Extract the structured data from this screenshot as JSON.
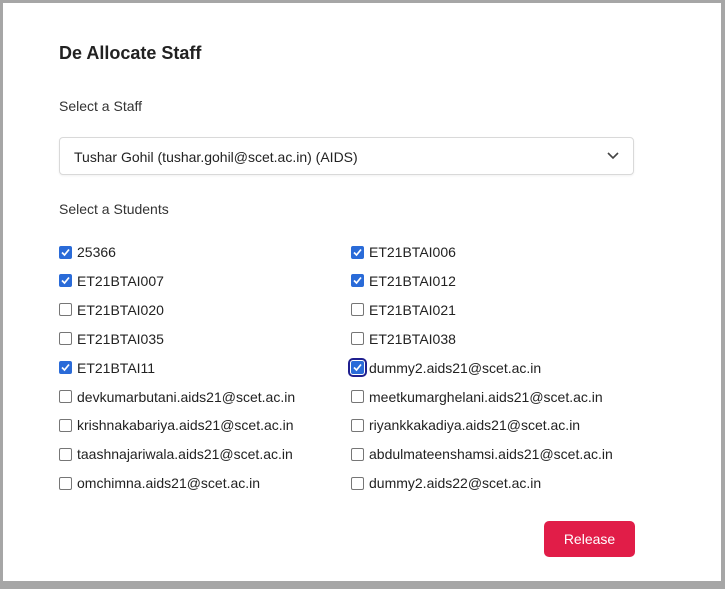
{
  "modal": {
    "title": "De Allocate Staff",
    "staff_label": "Select a Staff",
    "staff_selected": "Tushar Gohil (tushar.gohil@scet.ac.in) (AIDS)",
    "students_label": "Select a Students",
    "release_label": "Release"
  },
  "students": [
    {
      "label": "25366",
      "checked": true
    },
    {
      "label": "ET21BTAI006",
      "checked": true
    },
    {
      "label": "ET21BTAI007",
      "checked": true
    },
    {
      "label": "ET21BTAI012",
      "checked": true
    },
    {
      "label": "ET21BTAI020",
      "checked": false
    },
    {
      "label": "ET21BTAI021",
      "checked": false
    },
    {
      "label": "ET21BTAI035",
      "checked": false
    },
    {
      "label": "ET21BTAI038",
      "checked": false
    },
    {
      "label": "ET21BTAI11",
      "checked": true
    },
    {
      "label": "dummy2.aids21@scet.ac.in",
      "checked": true,
      "focused": true
    },
    {
      "label": "devkumarbutani.aids21@scet.ac.in",
      "checked": false
    },
    {
      "label": "meetkumarghelani.aids21@scet.ac.in",
      "checked": false
    },
    {
      "label": "krishnakabariya.aids21@scet.ac.in",
      "checked": false
    },
    {
      "label": "riyankkakadiya.aids21@scet.ac.in",
      "checked": false
    },
    {
      "label": "taashnajariwala.aids21@scet.ac.in",
      "checked": false
    },
    {
      "label": "abdulmateenshamsi.aids21@scet.ac.in",
      "checked": false
    },
    {
      "label": "omchimna.aids21@scet.ac.in",
      "checked": false
    },
    {
      "label": "dummy2.aids22@scet.ac.in",
      "checked": false
    }
  ],
  "colors": {
    "accent": "#2a6bd8",
    "release": "#e11d48"
  }
}
